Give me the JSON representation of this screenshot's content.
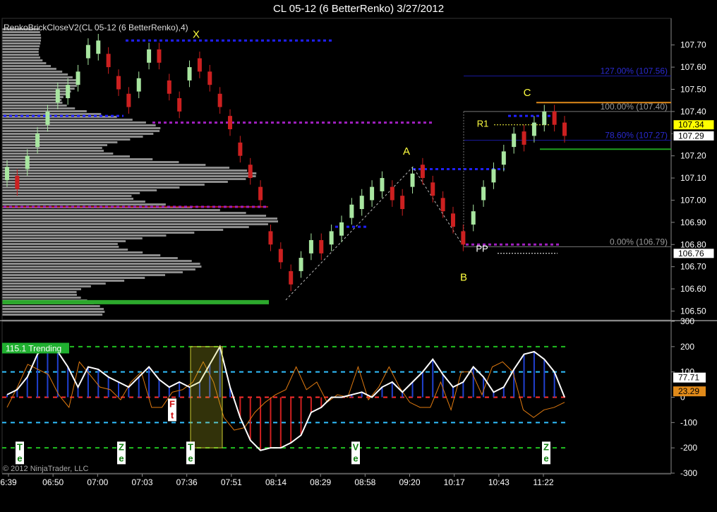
{
  "window": {
    "title": "CL 05-12 (6 BetterRenko)  3/27/2012"
  },
  "indicator_label": "RenkoBrickCloseV2(CL 05-12 (6 BetterRenko),4)",
  "copyright": "© 2012 NinjaTrader, LLC",
  "colors": {
    "background": "#000000",
    "up_candle": "#a8e6a0",
    "down_candle": "#cc2020",
    "volume_profile": "#8c8c8c",
    "blue_dash": "#2020ff",
    "purple_dash": "#a020c0",
    "fib_blue": "#1a1aa0",
    "fib_orange": "#e08a1a",
    "green_level": "#20a020",
    "cci_line": "#ffffff",
    "cci_fast": "#e07a10"
  },
  "chart_data": [
    {
      "type": "candlestick",
      "title": "CL 05-12 (6 BetterRenko)  3/27/2012",
      "ylim": [
        106.46,
        107.82
      ],
      "y_ticks": [
        "107.70",
        "107.60",
        "107.50",
        "107.40",
        "107.30",
        "107.20",
        "107.10",
        "107.00",
        "106.90",
        "106.80",
        "106.70",
        "106.60",
        "106.50"
      ],
      "x_ticks": [
        "6:39",
        "06:50",
        "07:00",
        "07:03",
        "07:36",
        "07:51",
        "08:14",
        "08:29",
        "08:58",
        "09:20",
        "10:17",
        "10:43",
        "11:22"
      ],
      "price_labels": [
        {
          "text": "107.34",
          "value": 107.34,
          "color": "#ffff00"
        },
        {
          "text": "107.29",
          "value": 107.29,
          "color": "#ffffff"
        },
        {
          "text": "106.76",
          "value": 106.76,
          "color": "#ffffff"
        }
      ],
      "fib_labels": [
        {
          "text": "127.00% (107.56)",
          "value": 107.56,
          "color": "#2a2ad0"
        },
        {
          "text": "100.00% (107.40)",
          "value": 107.4,
          "color": "#999999"
        },
        {
          "text": "78.60% (107.27)",
          "value": 107.27,
          "color": "#2a2ad0"
        },
        {
          "text": "0.00% (106.79)",
          "value": 106.79,
          "color": "#999999"
        }
      ],
      "pattern_labels": [
        {
          "text": "X",
          "value": 107.72
        },
        {
          "text": "A",
          "value": 107.18
        },
        {
          "text": "B",
          "value": 106.72
        },
        {
          "text": "C",
          "value": 107.45
        },
        {
          "text": "R1",
          "value": 107.34
        },
        {
          "text": "PP",
          "value": 106.78
        }
      ],
      "series": [
        {
          "values": [
            107.15,
            107.05,
            107.2,
            107.3,
            107.4,
            107.5,
            107.52,
            107.58,
            107.7,
            107.72,
            107.6,
            107.5,
            107.42,
            107.55,
            107.68,
            107.62,
            107.48,
            107.4,
            107.6,
            107.58,
            107.52,
            107.42,
            107.32,
            107.2,
            107.1,
            107.0,
            106.8,
            106.72,
            106.62,
            106.74,
            106.82,
            106.76,
            106.86,
            106.9,
            106.98,
            107.02,
            107.06,
            107.1,
            107.0,
            106.96,
            107.12,
            107.1,
            107.02,
            106.95,
            106.88,
            106.8,
            106.95,
            107.06,
            107.14,
            107.22,
            107.3,
            107.25,
            107.35,
            107.4,
            107.34,
            107.29
          ]
        }
      ]
    },
    {
      "type": "line",
      "name": "CCI",
      "ylim": [
        -300,
        300
      ],
      "y_ticks": [
        "300",
        "200",
        "100",
        "0",
        "-100",
        "-200",
        "-300"
      ],
      "levels": [
        200,
        100,
        0,
        -100,
        -200
      ],
      "value_labels": [
        {
          "text": "77.71",
          "value": 77.71,
          "color": "#ffffff"
        },
        {
          "text": "23.29",
          "value": 23.29,
          "color": "#e08a1a"
        }
      ],
      "trend_label": "115.1 Trending",
      "markers": [
        {
          "text": "Ft"
        },
        {
          "text": "Te"
        },
        {
          "text": "Ze"
        },
        {
          "text": "Te"
        },
        {
          "text": "Ve"
        },
        {
          "text": "Ze"
        }
      ],
      "series": [
        {
          "values": [
            10,
            30,
            80,
            170,
            210,
            180,
            120,
            40,
            120,
            110,
            80,
            60,
            40,
            80,
            120,
            70,
            40,
            60,
            40,
            60,
            130,
            200,
            40,
            -80,
            -170,
            -210,
            -200,
            -200,
            -180,
            -150,
            -60,
            -40,
            0,
            0,
            10,
            20,
            0,
            40,
            60,
            20,
            60,
            100,
            150,
            90,
            40,
            60,
            120,
            80,
            20,
            40,
            110,
            170,
            180,
            150,
            100,
            0
          ]
        },
        {
          "values": [
            -40,
            40,
            130,
            110,
            90,
            10,
            -40,
            140,
            90,
            40,
            30,
            -10,
            60,
            100,
            -40,
            -40,
            20,
            30,
            60,
            140,
            60,
            -80,
            -130,
            -120,
            -60,
            -20,
            10,
            30,
            120,
            30,
            60,
            -20,
            10,
            0,
            120,
            -10,
            40,
            120,
            40,
            -20,
            -40,
            -40,
            60,
            -50,
            100,
            100,
            10,
            120,
            140,
            100,
            -50,
            -80,
            -50,
            -40,
            -20
          ]
        }
      ]
    }
  ]
}
